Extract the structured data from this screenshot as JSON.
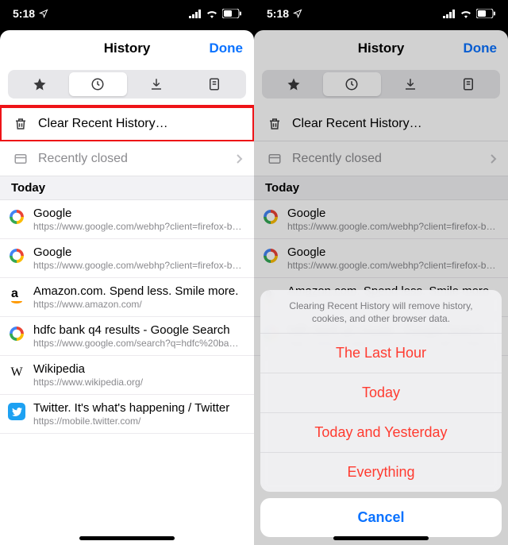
{
  "status": {
    "time": "5:18",
    "location_icon": "nav-arrow",
    "signal": "bars",
    "wifi": "wifi",
    "battery": "battery-half"
  },
  "header": {
    "title": "History",
    "done": "Done"
  },
  "tabs": {
    "bookmarks": "star",
    "history": "clock",
    "downloads": "download",
    "reading": "reading-list",
    "active": "history"
  },
  "actions": {
    "clear_label": "Clear Recent History…",
    "recently_closed_label": "Recently closed"
  },
  "sections": {
    "today": "Today"
  },
  "history": [
    {
      "favicon": "google",
      "title": "Google",
      "url": "https://www.google.com/webhp?client=firefox-b-m&…"
    },
    {
      "favicon": "google",
      "title": "Google",
      "url": "https://www.google.com/webhp?client=firefox-b-m&…"
    },
    {
      "favicon": "amazon",
      "title": "Amazon.com. Spend less. Smile more.",
      "url": "https://www.amazon.com/"
    },
    {
      "favicon": "google",
      "title": "hdfc bank q4 results - Google Search",
      "url": "https://www.google.com/search?q=hdfc%20bank%2…"
    },
    {
      "favicon": "wikipedia",
      "title": "Wikipedia",
      "url": "https://www.wikipedia.org/"
    },
    {
      "favicon": "twitter",
      "title": "Twitter. It's what's happening / Twitter",
      "url": "https://mobile.twitter.com/"
    }
  ],
  "history_right_count": 4,
  "actionsheet": {
    "message": "Clearing Recent History will remove history, cookies, and other browser data.",
    "options": [
      "The Last Hour",
      "Today",
      "Today and Yesterday",
      "Everything"
    ],
    "cancel": "Cancel"
  }
}
